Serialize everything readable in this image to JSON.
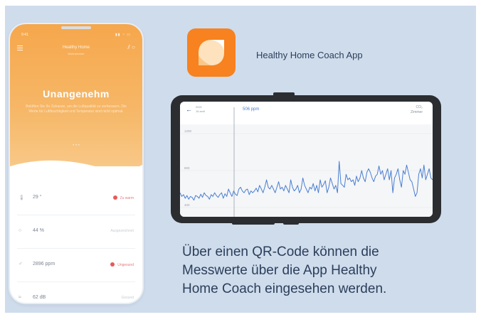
{
  "colors": {
    "background": "#cfdcec",
    "accent_orange": "#f7821f",
    "status_alert": "#e85a5a",
    "chart_line": "#4a7fd0",
    "text_dark": "#2c3e5a"
  },
  "phone": {
    "status_time": "9:41",
    "status_icons": "signal-wifi-battery",
    "device_name": "Healthy Home",
    "device_sub": "Wohnzimmer",
    "status_title": "Unangenehm",
    "status_description": "Belüften Sie Ihr Zuhause, um die Luftqualität zu verbessern. Die Werte für Luftfeuchtigkeit und Temperatur sind nicht optimal.",
    "readings": [
      {
        "icon": "thermometer-icon",
        "glyph": "🌡",
        "value": "29",
        "unit": "°",
        "status": "Zu warm",
        "alert": true
      },
      {
        "icon": "humidity-icon",
        "glyph": "○",
        "value": "44",
        "unit": "%",
        "status": "Ausgezeichnet",
        "alert": false
      },
      {
        "icon": "co2-icon",
        "glyph": "♂",
        "value": "2896",
        "unit": "ppm",
        "status": "Ungesund",
        "alert": true
      },
      {
        "icon": "noise-icon",
        "glyph": "≈",
        "value": "62",
        "unit": "dB",
        "status": "Gesund",
        "alert": false
      }
    ]
  },
  "app": {
    "icon": "healthy-home-coach-logo",
    "name": "Healthy Home Coach App"
  },
  "chart_panel": {
    "back_icon": "back-arrow-icon",
    "date_line1": "2021",
    "date_line2": "16 avril",
    "current_value": "506 ppm",
    "metric_line1": "CO₂",
    "metric_line2": "Zimmer"
  },
  "chart_data": {
    "type": "line",
    "title": "",
    "xlabel": "",
    "ylabel": "",
    "y_tick_labels": [
      "1200",
      "800",
      "400"
    ],
    "ylim": [
      300,
      1300
    ],
    "grid": true,
    "series": [
      {
        "values": [
          560,
          520,
          540,
          500,
          530,
          490,
          520,
          510,
          480,
          530,
          520,
          500,
          545,
          510,
          560,
          530,
          520,
          490,
          540,
          520,
          560,
          530,
          510,
          540,
          560,
          500,
          550,
          520,
          600,
          560,
          520,
          580,
          545,
          530,
          600,
          620,
          580,
          560,
          590,
          600,
          540,
          580,
          560,
          580,
          610,
          570,
          640,
          600,
          560,
          620,
          700,
          620,
          600,
          640,
          600,
          560,
          620,
          680,
          600,
          620,
          580,
          640,
          600,
          560,
          700,
          620,
          580,
          600,
          640,
          560,
          600,
          720,
          640,
          600,
          560,
          620,
          600,
          660,
          580,
          640,
          560,
          700,
          620,
          650,
          690,
          560,
          620,
          720,
          660,
          600,
          640,
          560,
          900,
          660,
          640,
          620,
          760,
          700,
          720,
          680,
          700,
          640,
          740,
          680,
          720,
          800,
          720,
          680,
          780,
          820,
          780,
          720,
          680,
          740,
          760,
          850,
          760,
          800,
          700,
          760,
          820,
          700,
          800,
          560,
          720,
          760,
          820,
          700,
          620,
          800,
          760,
          860,
          780,
          700,
          680,
          600,
          520,
          560,
          760,
          820,
          720,
          860,
          700,
          760,
          820,
          720,
          700
        ]
      }
    ]
  },
  "caption": [
    "Über einen QR-Code können die",
    "Messwerte über die App Healthy",
    "Home Coach eingesehen werden."
  ]
}
